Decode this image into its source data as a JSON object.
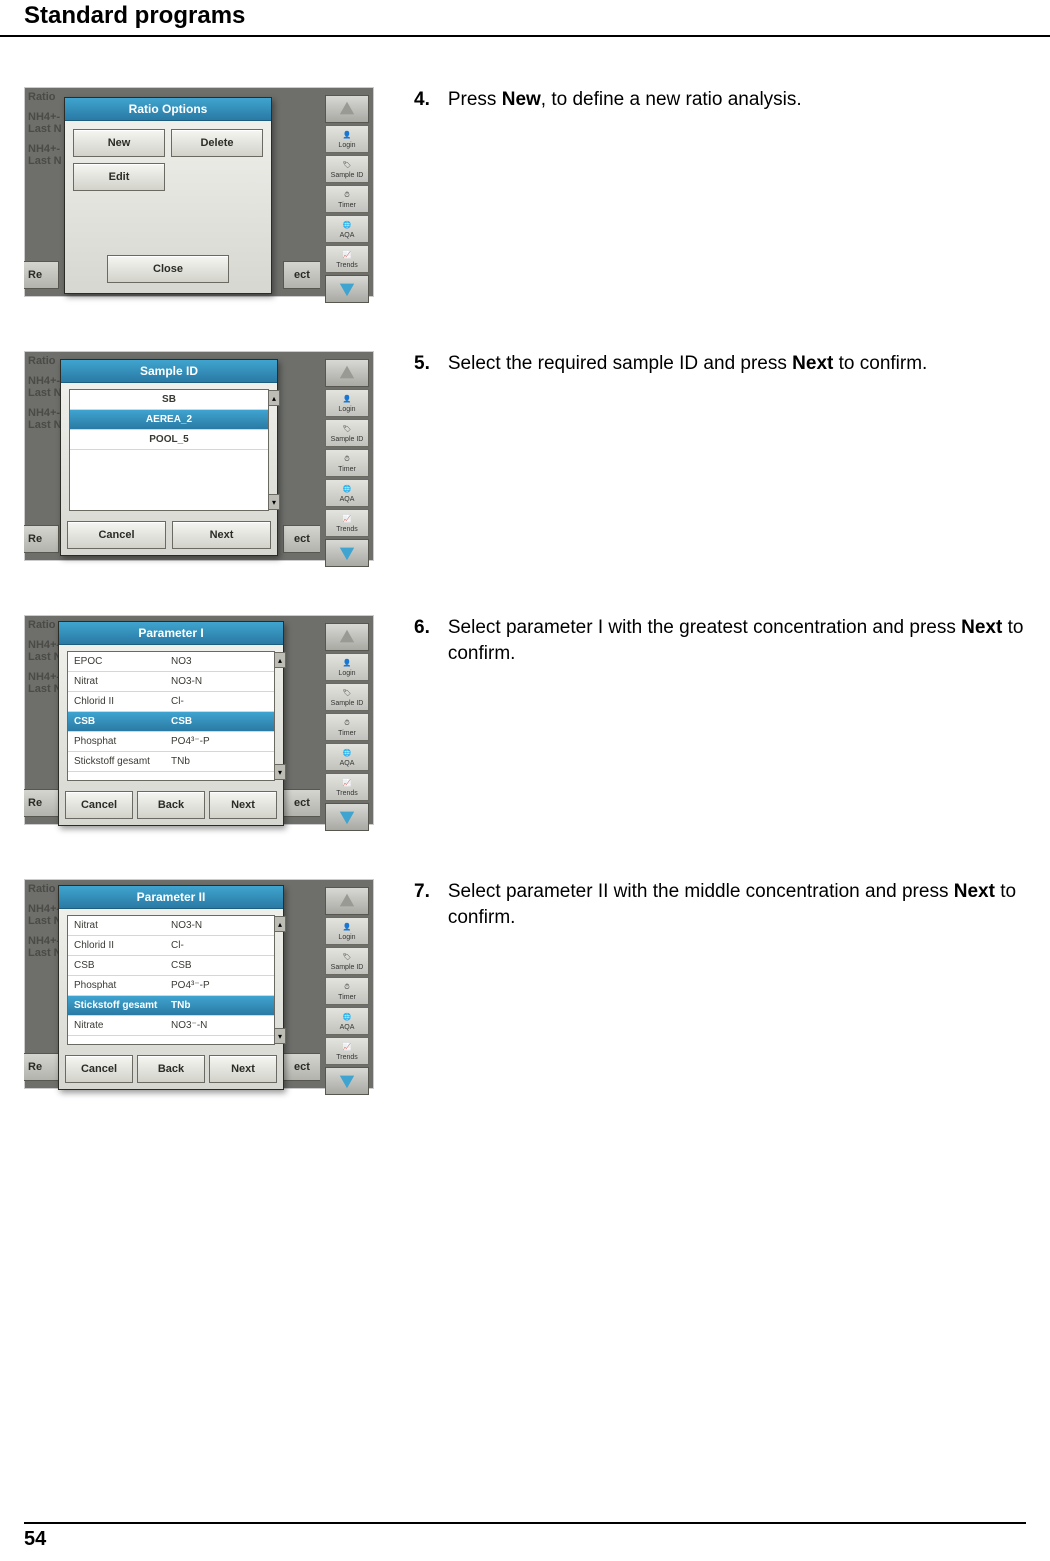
{
  "page": {
    "header": "Standard programs",
    "footer": "54"
  },
  "sidebar": {
    "login": "Login",
    "sample_id": "Sample ID",
    "timer": "Timer",
    "aqa": "AQA",
    "trends": "Trends"
  },
  "bg": {
    "ratio": "Ratio",
    "nh4": "NH4+-",
    "lastn": "Last N",
    "re": "Re",
    "ect": "ect"
  },
  "steps": [
    {
      "num": "4.",
      "text_before": "Press ",
      "bold1": "New",
      "text_after": ", to define a new ratio analysis.",
      "dialog": {
        "title": "Ratio Options",
        "buttons": {
          "new": "New",
          "delete": "Delete",
          "edit": "Edit",
          "close": "Close"
        }
      }
    },
    {
      "num": "5.",
      "text_before": "Select the required sample ID and press ",
      "bold1": "Next",
      "text_after": " to confirm.",
      "dialog": {
        "title": "Sample ID",
        "items": [
          "SB",
          "AEREA_2",
          "POOL_5"
        ],
        "selected": 1,
        "buttons": {
          "cancel": "Cancel",
          "next": "Next"
        }
      }
    },
    {
      "num": "6.",
      "text_before": "Select parameter I with the greatest concentration and press ",
      "bold1": "Next",
      "text_after": " to confirm.",
      "dialog": {
        "title": "Parameter I",
        "items": [
          [
            "EPOC",
            "NO3"
          ],
          [
            "Nitrat",
            "NO3-N"
          ],
          [
            "Chlorid II",
            "Cl-"
          ],
          [
            "CSB",
            "CSB"
          ],
          [
            "Phosphat",
            "PO4³⁻-P"
          ],
          [
            "Stickstoff gesamt",
            "TNb"
          ]
        ],
        "selected": 3,
        "buttons": {
          "cancel": "Cancel",
          "back": "Back",
          "next": "Next"
        }
      }
    },
    {
      "num": "7.",
      "text_before": "Select parameter II with the middle concentration and press ",
      "bold1": "Next",
      "text_after": " to confirm.",
      "dialog": {
        "title": "Parameter II",
        "items": [
          [
            "Nitrat",
            "NO3-N"
          ],
          [
            "Chlorid II",
            "Cl-"
          ],
          [
            "CSB",
            "CSB"
          ],
          [
            "Phosphat",
            "PO4³⁻-P"
          ],
          [
            "Stickstoff gesamt",
            "TNb"
          ],
          [
            "Nitrate",
            "NO3⁻-N"
          ]
        ],
        "selected": 4,
        "buttons": {
          "cancel": "Cancel",
          "back": "Back",
          "next": "Next"
        }
      }
    }
  ]
}
